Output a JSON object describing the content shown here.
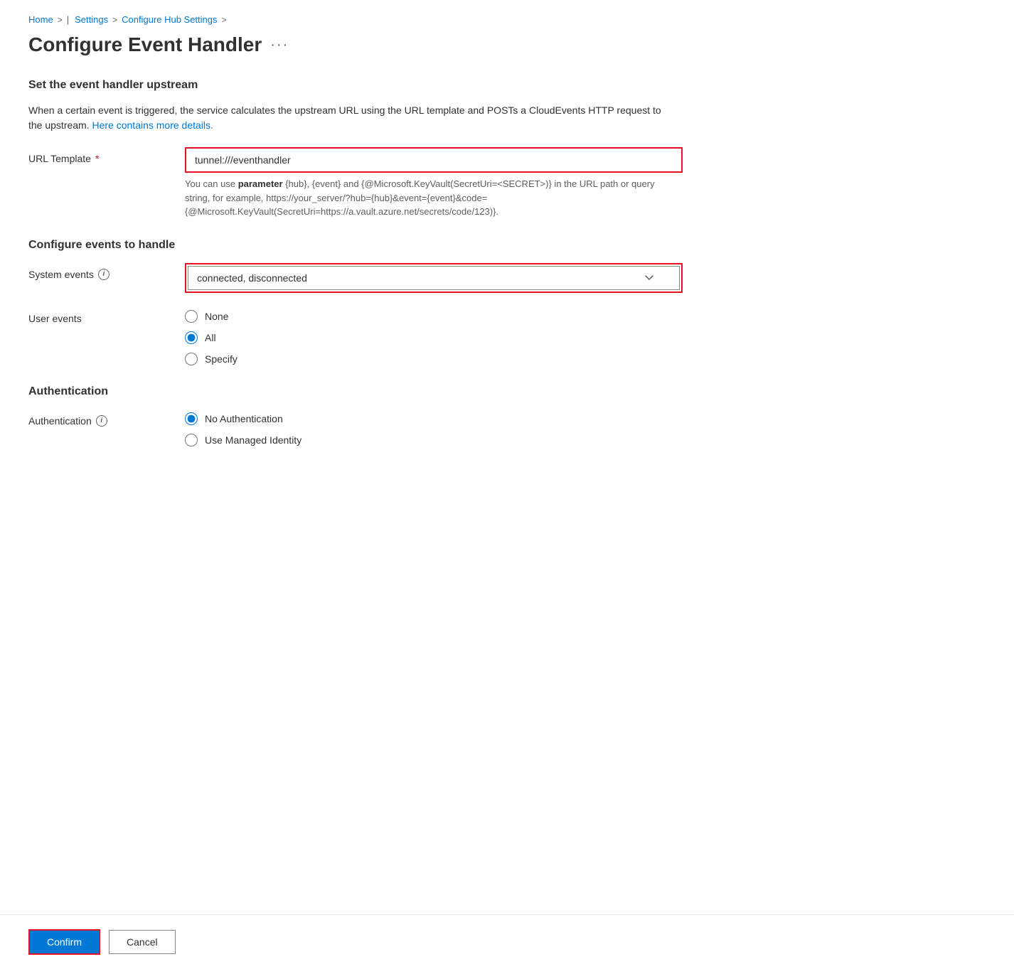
{
  "breadcrumb": {
    "home": "Home",
    "settings": "Settings",
    "configure_hub": "Configure Hub Settings",
    "sep": ">"
  },
  "page": {
    "title": "Configure Event Handler",
    "ellipsis": "···"
  },
  "sections": {
    "upstream": {
      "title": "Set the event handler upstream",
      "description_part1": "When a certain event is triggered, the service calculates the upstream URL using the URL template and POSTs a CloudEvents HTTP request to the upstream.",
      "description_link": "Here contains more details.",
      "url_template": {
        "label": "URL Template",
        "required": "*",
        "value": "tunnel:///eventhandler",
        "hint_prefix": "You can use ",
        "hint_bold": "parameter",
        "hint_suffix": " {hub}, {event} and {@Microsoft.KeyVault(SecretUri=<SECRET>)} in the URL path or query string, for example, https://your_server/?hub={hub}&event={event}&code={@Microsoft.KeyVault(SecretUri=https://a.vault.azure.net/secrets/code/123)}."
      }
    },
    "configure_events": {
      "title": "Configure events to handle",
      "system_events": {
        "label": "System events",
        "value": "connected, disconnected",
        "options": [
          "connected",
          "disconnected",
          "connected, disconnected"
        ]
      },
      "user_events": {
        "label": "User events",
        "options": [
          {
            "value": "none",
            "label": "None",
            "checked": false
          },
          {
            "value": "all",
            "label": "All",
            "checked": true
          },
          {
            "value": "specify",
            "label": "Specify",
            "checked": false
          }
        ]
      }
    },
    "authentication": {
      "title": "Authentication",
      "label": "Authentication",
      "options": [
        {
          "value": "no_auth",
          "label": "No Authentication",
          "checked": true
        },
        {
          "value": "managed_identity",
          "label": "Use Managed Identity",
          "checked": false
        }
      ]
    }
  },
  "footer": {
    "confirm_label": "Confirm",
    "cancel_label": "Cancel"
  }
}
